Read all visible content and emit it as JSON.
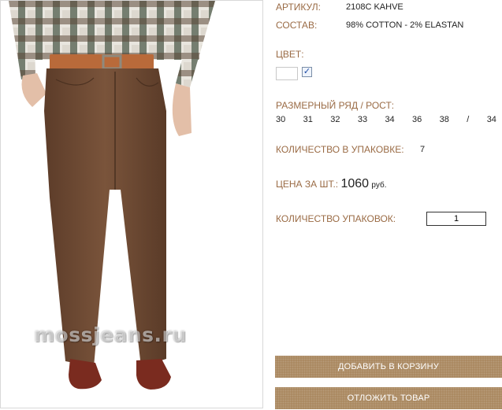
{
  "product": {
    "article_label": "АРТИКУЛ:",
    "article_value": "2108C KAHVE",
    "composition_label": "СОСТАВ:",
    "composition_value": "98% COTTON - 2% ELASTAN",
    "color_label": "ЦВЕТ:",
    "color_checkbox": "✓",
    "sizes_label": "РАЗМЕРНЫЙ РЯД / РОСТ:",
    "sizes": [
      "30",
      "31",
      "32",
      "33",
      "34",
      "36",
      "38",
      "/",
      "34"
    ],
    "pack_qty_label": "КОЛИЧЕСТВО В УПАКОВКЕ:",
    "pack_qty_value": "7",
    "price_label": "ЦЕНА ЗА ШТ.:",
    "price_value": "1060",
    "price_currency": "руб.",
    "order_packs_label": "КОЛИЧЕСТВО УПАКОВОК:",
    "order_packs_value": "1"
  },
  "image": {
    "watermark": "mossjeans.ru"
  },
  "actions": {
    "add_to_cart": "ДОБАВИТЬ В КОРЗИНУ",
    "postpone": "ОТЛОЖИТЬ ТОВАР"
  },
  "colors": {
    "label": "#9a6b45",
    "button": "#a8865d",
    "pants": "#6e4a34"
  }
}
